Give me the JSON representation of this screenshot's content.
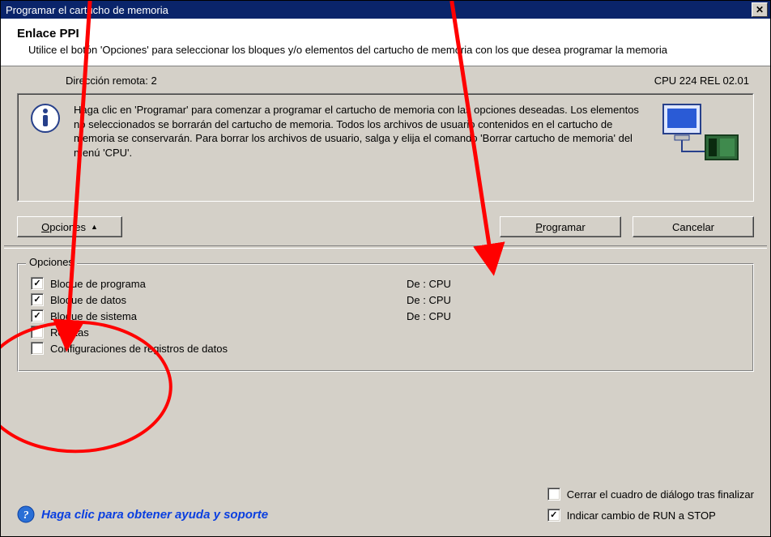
{
  "window": {
    "title": "Programar el cartucho de memoria"
  },
  "header": {
    "title": "Enlace PPI",
    "desc": "Utilice el botón 'Opciones' para seleccionar los bloques y/o elementos del cartucho de memoria con los que desea programar la memoria"
  },
  "info_strip": {
    "remote": "Dirección remota: 2",
    "cpu": "CPU 224 REL 02.01"
  },
  "info_panel": {
    "text": "Haga clic en 'Programar' para comenzar a programar el cartucho de memoria con las opciones deseadas. Los elementos no seleccionados se borrarán del cartucho de memoria. Todos los archivos de usuario contenidos en el cartucho de memoria se conservarán. Para borrar los archivos de usuario, salga y elija el comando 'Borrar cartucho de memoria' del menú 'CPU'."
  },
  "buttons": {
    "options": "Opciones",
    "program": "Programar",
    "cancel": "Cancelar"
  },
  "options_group": {
    "legend": "Opciones",
    "items": [
      {
        "label": "Bloque de programa",
        "checked": true,
        "source": "De : CPU"
      },
      {
        "label": "Bloque de datos",
        "checked": true,
        "source": "De : CPU"
      },
      {
        "label": "Bloque de sistema",
        "checked": true,
        "source": "De : CPU"
      },
      {
        "label": "Recetas",
        "checked": false,
        "source": ""
      },
      {
        "label": "Configuraciones de registros de datos",
        "checked": false,
        "source": ""
      }
    ]
  },
  "footer": {
    "help": "Haga clic para obtener ayuda y soporte",
    "close_after": {
      "label": "Cerrar el cuadro de diálogo tras finalizar",
      "checked": false
    },
    "run_stop": {
      "label": "Indicar cambio de RUN a STOP",
      "checked": true
    }
  }
}
